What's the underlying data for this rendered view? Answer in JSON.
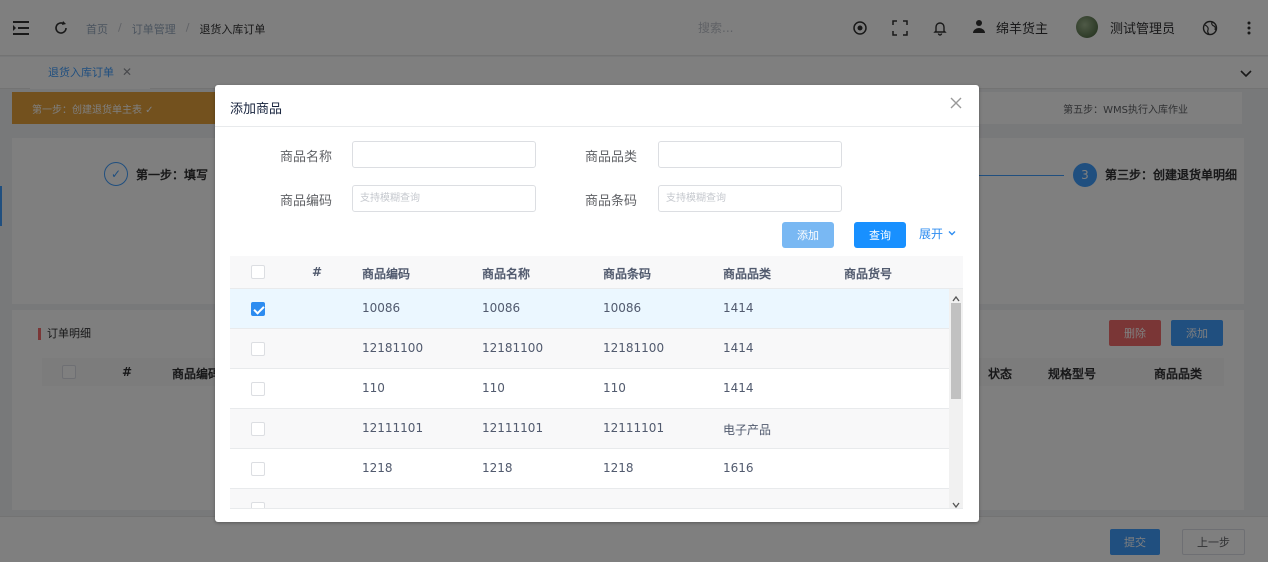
{
  "header": {
    "breadcrumb": [
      "首页",
      "订单管理",
      "退货入库订单"
    ],
    "search_placeholder": "搜索...",
    "user_name": "绵羊货主",
    "admin_name": "测试管理员"
  },
  "tabs": {
    "active": "退货入库订单"
  },
  "background_page": {
    "step1_done": "第一步：创建退货单主表 ✓",
    "step5": "第五步：WMS执行入库作业",
    "step_fill": "第一步：填写",
    "step3_num": "3",
    "step3_title": "第三步：创建退货单明细",
    "order_detail_title": "订单明细",
    "delete_btn": "删除",
    "add_btn": "添加",
    "columns_left": [
      "#",
      "商品编码"
    ],
    "columns_right": [
      "状态",
      "规格型号",
      "商品品类"
    ],
    "submit_btn": "提交",
    "prev_btn": "上一步",
    "colors": {
      "warning": "#e6a23c",
      "danger": "#f56c6c",
      "primary": "#409eff"
    }
  },
  "dialog": {
    "title": "添加商品",
    "form": {
      "name_label": "商品名称",
      "category_label": "商品品类",
      "code_label": "商品编码",
      "code_placeholder": "支持模糊查询",
      "barcode_label": "商品条码",
      "barcode_placeholder": "支持模糊查询"
    },
    "buttons": {
      "add": "添加",
      "query": "查询",
      "expand": "展开"
    },
    "table": {
      "columns": [
        "#",
        "商品编码",
        "商品名称",
        "商品条码",
        "商品品类",
        "商品货号"
      ],
      "rows": [
        {
          "checked": true,
          "code": "10086",
          "name": "10086",
          "barcode": "10086",
          "category": "1414",
          "sku": ""
        },
        {
          "checked": false,
          "code": "12181100",
          "name": "12181100",
          "barcode": "12181100",
          "category": "1414",
          "sku": ""
        },
        {
          "checked": false,
          "code": "110",
          "name": "110",
          "barcode": "110",
          "category": "1414",
          "sku": ""
        },
        {
          "checked": false,
          "code": "12111101",
          "name": "12111101",
          "barcode": "12111101",
          "category": "电子产品",
          "sku": ""
        },
        {
          "checked": false,
          "code": "1218",
          "name": "1218",
          "barcode": "1218",
          "category": "1616",
          "sku": ""
        },
        {
          "checked": false,
          "code": "...",
          "name": "...",
          "barcode": "...",
          "category": "...",
          "sku": ""
        }
      ]
    }
  }
}
